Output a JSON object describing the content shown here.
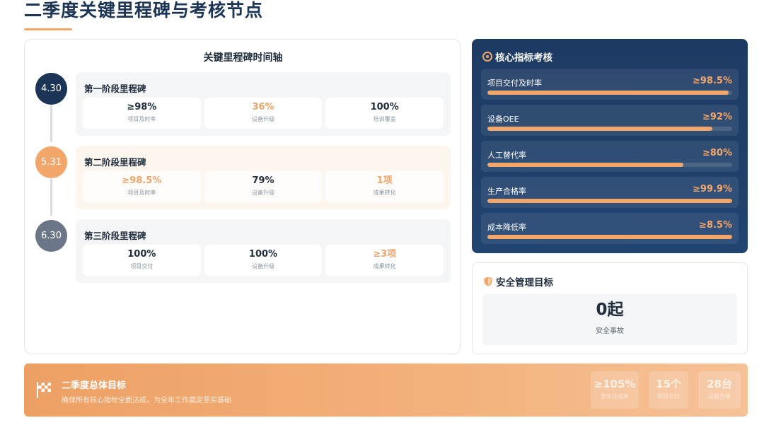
{
  "page": {
    "title": "二季度关键里程碑与考核节点"
  },
  "timeline": {
    "title": "关键里程碑时间轴",
    "stages": [
      {
        "date": "4.30",
        "circle_color": "#1c3556",
        "title": "第一阶段里程碑",
        "metrics": [
          {
            "value": "≥98%",
            "label": "项目及时率",
            "highlight": false
          },
          {
            "value": "36%",
            "label": "设备升级",
            "highlight": true
          },
          {
            "value": "100%",
            "label": "培训覆盖",
            "highlight": false
          }
        ]
      },
      {
        "date": "5.31",
        "circle_color": "#f2a66a",
        "title": "第二阶段里程碑",
        "metrics": [
          {
            "value": "≥98.5%",
            "label": "项目及时率",
            "highlight": true
          },
          {
            "value": "79%",
            "label": "设备升级",
            "highlight": false
          },
          {
            "value": "1项",
            "label": "成果转化",
            "highlight": true
          }
        ]
      },
      {
        "date": "6.30",
        "circle_color": "#6b7788",
        "title": "第三阶段里程碑",
        "metrics": [
          {
            "value": "100%",
            "label": "项目交付",
            "highlight": false
          },
          {
            "value": "100%",
            "label": "设备升级",
            "highlight": false
          },
          {
            "value": "≥3项",
            "label": "成果转化",
            "highlight": true
          }
        ]
      }
    ]
  },
  "kpi": {
    "title": "核心指标考核",
    "accent_color": "#f2a66a",
    "items": [
      {
        "label": "项目交付及时率",
        "value": "≥98.5%",
        "progress": 0.985
      },
      {
        "label": "设备OEE",
        "value": "≥92%",
        "progress": 0.92
      },
      {
        "label": "人工替代率",
        "value": "≥80%",
        "progress": 0.8
      },
      {
        "label": "生产合格率",
        "value": "≥99.9%",
        "progress": 0.999
      },
      {
        "label": "成本降低率",
        "value": "≥8.5%",
        "progress": 1.0
      }
    ]
  },
  "safety": {
    "title": "安全管理目标",
    "value": "0起",
    "label": "安全事故"
  },
  "goal": {
    "title": "二季度总体目标",
    "description": "确保所有核心指标全面达成，为全年工作奠定坚实基础",
    "stats": [
      {
        "value": "≥105%",
        "label": "整体达成率"
      },
      {
        "value": "15个",
        "label": "项目交付"
      },
      {
        "value": "28台",
        "label": "设备升级"
      }
    ]
  }
}
